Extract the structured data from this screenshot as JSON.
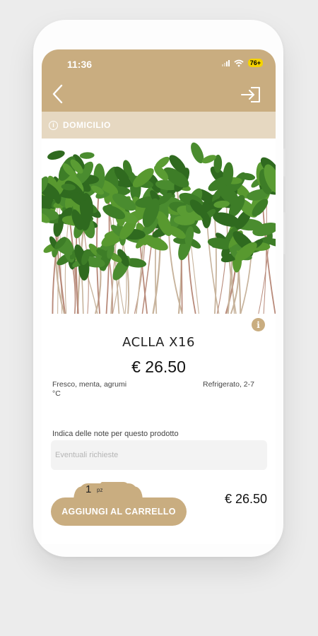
{
  "status": {
    "time": "11:36",
    "battery": "76+"
  },
  "header": {
    "back_icon": "chevron-left-icon",
    "login_icon": "login-icon",
    "color": "#c9ad80"
  },
  "delivery": {
    "label": "DOMICILIO",
    "icon": "info-icon"
  },
  "product": {
    "image": "microgreens-photo",
    "name": "ACLLA X16",
    "price": "€ 26.50",
    "description": "Fresco, menta, agrumi",
    "storage_line1": "Refrigerato, 2-7",
    "storage_line2": "°C"
  },
  "notes": {
    "label": "Indica delle note per questo prodotto",
    "placeholder": "Eventuali richieste",
    "value": ""
  },
  "cart": {
    "quantity": "1",
    "unit": "pz",
    "add_label": "AGGIUNGI AL CARRELLO",
    "total": "€ 26.50"
  }
}
